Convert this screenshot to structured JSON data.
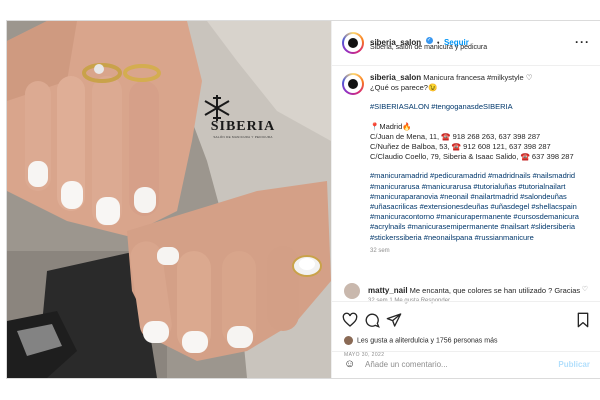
{
  "post": {
    "image_alt": "Manicura francesa milkystyle",
    "logo": {
      "name": "SIBERIA",
      "tagline": "SALÓN DE MANICURA Y PEDICURA"
    }
  },
  "header": {
    "username": "siberia_salon",
    "separator": "•",
    "follow_label": "Seguir",
    "subtitle": "Siberia, salón de manicura y pedicura",
    "more_icon": "ellipsis-icon"
  },
  "caption": {
    "username": "siberia_salon",
    "line1": "Manicura francesa #milkystyle ♡",
    "line2": "¿Qué os parece?😉",
    "tags1": "#SIBERIASALON #tengoganasdeSIBERIA",
    "city": "📍Madrid🔥",
    "addr1": "C/Juan de Mena, 11, ☎️ 918 268 263, 637 398 287",
    "addr2": "C/Nuñez de Balboa, 53, ☎️ 912 608 121, 637 398 287",
    "addr3": "C/Claudio Coello, 79, Siberia & Isaac Salido, ☎️ 637 398 287",
    "hashtags": "#manicuramadrid #pedicuramadrid #madridnails #nailsmadrid #manicurarusa #manicurarusa #tutorialuñas #tutorialnailart #manicuraparanovia #neonail #nailartmadrid #salondeuñas #uñasacrilicas #extensionesdeuñas #uñasdegel #shellacspain #manicuracontorno #manicurapermanente #cursosdemanicura #acrylnails #manicurasemipermanente #nailsart #slidersiberia #stickerssiberia #neonailspana #russianmanicure",
    "time": "32 sem"
  },
  "comment": {
    "username": "matty_nail",
    "text": "Me encanta, que colores se han utilizado ? Gracias",
    "meta": "32 sem   1 Me gusta   Responder"
  },
  "actions": {
    "icons": [
      "heart-icon",
      "comment-icon",
      "share-icon",
      "bookmark-icon"
    ],
    "likes_text": "Les gusta a aliterdulcia y 1756 personas más",
    "date": "MAYO 30, 2022"
  },
  "add_comment": {
    "emoji_icon": "smile-icon",
    "placeholder": "Añade un comentario...",
    "post_label": "Publicar"
  },
  "colors": {
    "link": "#00376b",
    "follow": "#0095f6",
    "muted": "#8e8e8e",
    "post_disabled": "#b2dffc"
  }
}
